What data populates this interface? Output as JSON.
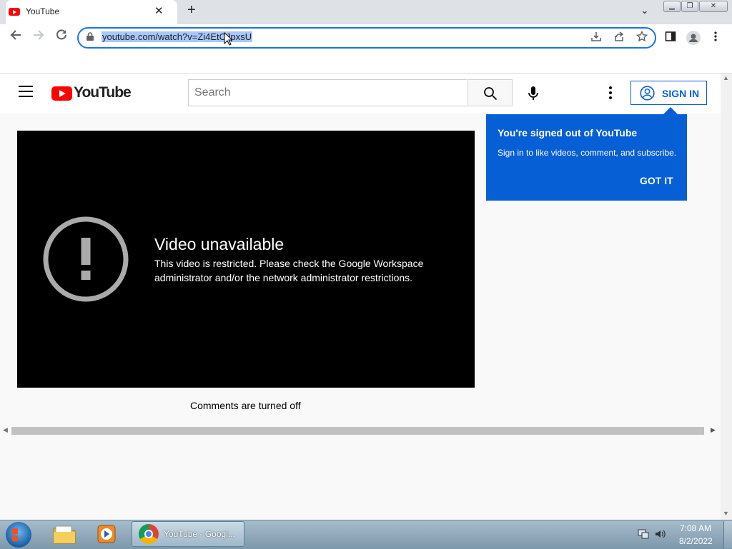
{
  "browser": {
    "tab_title": "YouTube",
    "tab_close_glyph": "✕",
    "new_tab_glyph": "+",
    "tab_search_glyph": "⌄",
    "url": "youtube.com/watch?v=Zi4EtCJpxsU",
    "icons": [
      "back-icon",
      "forward-icon",
      "reload-icon",
      "lock-icon",
      "install-icon",
      "share-icon",
      "bookmark-star-icon",
      "side-panel-icon",
      "profile-icon",
      "menu-dots-icon"
    ]
  },
  "youtube": {
    "logo_text": "YouTube",
    "search_placeholder": "Search",
    "sign_in_label": "SIGN IN",
    "tooltip": {
      "title": "You're signed out of YouTube",
      "body": "Sign in to like videos, comment, and subscribe.",
      "button": "GOT IT"
    },
    "player": {
      "title": "Video unavailable",
      "message": "This video is restricted. Please check the Google Workspace administrator and/or the network administrator restrictions."
    },
    "comments_status": "Comments are turned off"
  },
  "taskbar": {
    "chrome_task_label": "YouTube - Googl...",
    "time": "7:08 AM",
    "date": "8/2/2022"
  },
  "colors": {
    "youtube_red": "#ff0000",
    "youtube_blue": "#065fd4",
    "omnibox_focus": "#1a73e8"
  }
}
